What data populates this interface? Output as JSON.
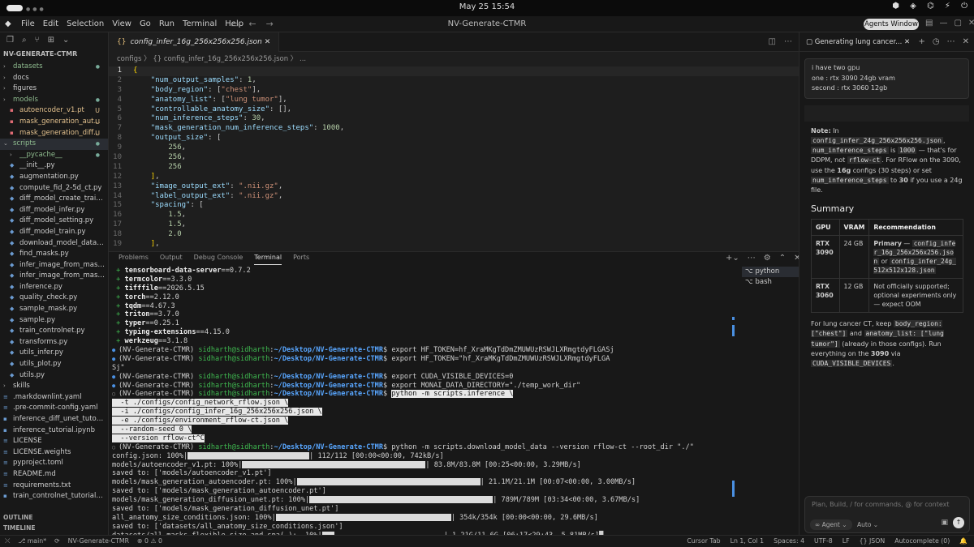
{
  "system": {
    "datetime": "May 25  15:54"
  },
  "menubar": {
    "items": [
      "File",
      "Edit",
      "Selection",
      "View",
      "Go",
      "Run",
      "Terminal",
      "Help"
    ],
    "title": "NV-Generate-CTMR",
    "agents_button": "Agents Window"
  },
  "sidebar": {
    "project": "NV-GENERATE-CTMR",
    "items": [
      {
        "label": "datasets",
        "type": "folder",
        "status": "dot",
        "depth": 0
      },
      {
        "label": "docs",
        "type": "folder",
        "status": "",
        "depth": 0
      },
      {
        "label": "figures",
        "type": "folder",
        "status": "",
        "depth": 0
      },
      {
        "label": "models",
        "type": "folder",
        "status": "dot",
        "depth": 0
      },
      {
        "label": "autoencoder_v1.pt",
        "type": "model",
        "status": "U",
        "depth": 1
      },
      {
        "label": "mask_generation_aut...",
        "type": "model",
        "status": "U",
        "depth": 1
      },
      {
        "label": "mask_generation_diff...",
        "type": "model",
        "status": "U",
        "depth": 1
      },
      {
        "label": "scripts",
        "type": "folder-open",
        "status": "dot",
        "depth": 0,
        "selected": true
      },
      {
        "label": "__pycache__",
        "type": "folder",
        "status": "dot",
        "depth": 1
      },
      {
        "label": "__init__.py",
        "type": "py",
        "status": "",
        "depth": 1
      },
      {
        "label": "augmentation.py",
        "type": "py",
        "status": "",
        "depth": 1
      },
      {
        "label": "compute_fid_2-5d_ct.py",
        "type": "py",
        "status": "",
        "depth": 1
      },
      {
        "label": "diff_model_create_trainin...",
        "type": "py",
        "status": "",
        "depth": 1
      },
      {
        "label": "diff_model_infer.py",
        "type": "py",
        "status": "",
        "depth": 1
      },
      {
        "label": "diff_model_setting.py",
        "type": "py",
        "status": "",
        "depth": 1
      },
      {
        "label": "diff_model_train.py",
        "type": "py",
        "status": "",
        "depth": 1
      },
      {
        "label": "download_model_data.py",
        "type": "py",
        "status": "",
        "depth": 1
      },
      {
        "label": "find_masks.py",
        "type": "py",
        "status": "",
        "depth": 1
      },
      {
        "label": "infer_image_from_mask_b...",
        "type": "py",
        "status": "",
        "depth": 1
      },
      {
        "label": "infer_image_from_mask.py",
        "type": "py",
        "status": "",
        "depth": 1
      },
      {
        "label": "inference.py",
        "type": "py",
        "status": "",
        "depth": 1
      },
      {
        "label": "quality_check.py",
        "type": "py",
        "status": "",
        "depth": 1
      },
      {
        "label": "sample_mask.py",
        "type": "py",
        "status": "",
        "depth": 1
      },
      {
        "label": "sample.py",
        "type": "py",
        "status": "",
        "depth": 1
      },
      {
        "label": "train_controlnet.py",
        "type": "py",
        "status": "",
        "depth": 1
      },
      {
        "label": "transforms.py",
        "type": "py",
        "status": "",
        "depth": 1
      },
      {
        "label": "utils_infer.py",
        "type": "py",
        "status": "",
        "depth": 1
      },
      {
        "label": "utils_plot.py",
        "type": "py",
        "status": "",
        "depth": 1
      },
      {
        "label": "utils.py",
        "type": "py",
        "status": "",
        "depth": 1
      },
      {
        "label": "skills",
        "type": "folder",
        "status": "",
        "depth": 0
      },
      {
        "label": ".markdownlint.yaml",
        "type": "file",
        "status": "",
        "depth": 0
      },
      {
        "label": ".pre-commit-config.yaml",
        "type": "file",
        "status": "",
        "depth": 0
      },
      {
        "label": "inference_diff_unet_tutorial...",
        "type": "nb",
        "status": "",
        "depth": 0
      },
      {
        "label": "inference_tutorial.ipynb",
        "type": "nb",
        "status": "",
        "depth": 0
      },
      {
        "label": "LICENSE",
        "type": "file",
        "status": "",
        "depth": 0
      },
      {
        "label": "LICENSE.weights",
        "type": "file",
        "status": "",
        "depth": 0
      },
      {
        "label": "pyproject.toml",
        "type": "file",
        "status": "",
        "depth": 0
      },
      {
        "label": "README.md",
        "type": "file",
        "status": "",
        "depth": 0
      },
      {
        "label": "requirements.txt",
        "type": "file",
        "status": "",
        "depth": 0
      },
      {
        "label": "train_controlnet_tutorial.ipy...",
        "type": "nb",
        "status": "",
        "depth": 0
      }
    ],
    "outline": "OUTLINE",
    "timeline": "TIMELINE"
  },
  "editor": {
    "tab": "config_infer_16g_256x256x256.json",
    "breadcrumb": "configs 〉 {} config_infer_16g_256x256x256.json 〉 ...",
    "lines": [
      "{",
      "    \"num_output_samples\": 1,",
      "    \"body_region\": [\"chest\"],",
      "    \"anatomy_list\": [\"lung tumor\"],",
      "    \"controllable_anatomy_size\": [],",
      "    \"num_inference_steps\": 30,",
      "    \"mask_generation_num_inference_steps\": 1000,",
      "    \"output_size\": [",
      "        256,",
      "        256,",
      "        256",
      "    ],",
      "    \"image_output_ext\": \".nii.gz\",",
      "    \"label_output_ext\": \".nii.gz\",",
      "    \"spacing\": [",
      "        1.5,",
      "        1.5,",
      "        2.0",
      "    ],"
    ]
  },
  "panel": {
    "tabs": [
      "Problems",
      "Output",
      "Debug Console",
      "Terminal",
      "Ports"
    ],
    "active": "Terminal",
    "terminals": [
      "python",
      "bash"
    ],
    "terminal_lines": [
      "+ tensorboard-data-server==0.7.2",
      "+ termcolor==3.3.0",
      "+ tifffile==2026.5.15",
      "+ torch==2.12.0",
      "+ tqdm==4.67.3",
      "+ triton==3.7.0",
      "+ typer==0.25.1",
      "+ typing-extensions==4.15.0",
      "+ werkzeug==3.1.8",
      "(NV-Generate-CTMR) sidharth@sidharth:~/Desktop/NV-Generate-CTMR$ export HF_TOKEN=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",
      "(NV-Generate-CTMR) sidharth@sidharth:~/Desktop/NV-Generate-CTMR$ export HF_TOKEN=\"hf_XraMKgTdDmZMUWUzRSWJLXRmgtdyFLGA",
      "Sj\"",
      "(NV-Generate-CTMR) sidharth@sidharth:~/Desktop/NV-Generate-CTMR$ export CUDA_VISIBLE_DEVICES=0",
      "(NV-Generate-CTMR) sidharth@sidharth:~/Desktop/NV-Generate-CTMR$ export MONAI_DATA_DIRECTORY=\"./temp_work_dir\"",
      "(NV-Generate-CTMR) sidharth@sidharth:~/Desktop/NV-Generate-CTMR$ python -m scripts.inference \\",
      "  -t ./configs/config_network_rflow.json \\",
      "  -i ./configs/config_infer_16g_256x256x256.json \\",
      "  -e ./configs/environment_rflow-ct.json \\",
      "  --random-seed 0 \\",
      "  --version rflow-ct^C",
      "(NV-Generate-CTMR) sidharth@sidharth:~/Desktop/NV-Generate-CTMR$ python -m scripts.download_model_data --version rflow-ct --root_dir \"./\"",
      "config.json: 100%|",
      "models/autoencoder_v1.pt: 100%|",
      "saved to: ['models/autoencoder_v1.pt']",
      "models/mask_generation_autoencoder.pt: 100%|",
      "saved to: ['models/mask_generation_autoencoder.pt']",
      "models/mask_generation_diffusion_unet.pt: 100%|",
      "saved to: ['models/mask_generation_diffusion_unet.pt']",
      "all_anatomy_size_conditions.json: 100%|",
      "saved to: ['datasets/all_anatomy_size_conditions.json']",
      "datasets/all_masks_flexible_size_and_spa(…):  10%|"
    ],
    "progress": [
      {
        "line": 21,
        "tail": "| 112/112 [00:00<00:00, 742kB/s]",
        "fill": 1.0
      },
      {
        "line": 22,
        "tail": "| 83.8M/83.8M [00:25<00:00, 3.29MB/s]",
        "fill": 1.0
      },
      {
        "line": 24,
        "tail": "| 21.1M/21.1M [00:07<00:00, 3.00MB/s]",
        "fill": 1.0
      },
      {
        "line": 26,
        "tail": "| 789M/789M [03:34<00:00, 3.67MB/s]",
        "fill": 1.0
      },
      {
        "line": 28,
        "tail": "| 354k/354k [00:00<00:00, 29.6MB/s]",
        "fill": 1.0
      },
      {
        "line": 30,
        "tail": "| 1.21G/11.6G [06:17<29:43, 5.81MB/s]",
        "fill": 0.1
      }
    ]
  },
  "agent": {
    "tab_title": "Generating lung cancer...",
    "user_message": [
      "i have two gpu",
      "one : rtx 3090 24gb vram",
      "second : rtx 3060 12gb"
    ],
    "code_lines": [
      {
        "t": "c",
        "v": "# 4) Download weights + mask DB (needed"
      },
      {
        "t": "x",
        "v": "python -m scripts.download_model_data --"
      },
      {
        "t": "x",
        "v": ""
      },
      {
        "t": "c",
        "v": "# 5) Run on 3090"
      },
      {
        "t": "x",
        "v": "python -m scripts.inference \\"
      },
      {
        "t": "x",
        "v": "  -t ./configs/config_network_rflow.json"
      },
      {
        "t": "x",
        "v": "  -i ./configs/config_infer_16g_256x256x"
      },
      {
        "t": "x",
        "v": "  -e ./configs/environment_rflow-ct.json"
      },
      {
        "t": "x",
        "v": "  --random-seed 0 \\"
      },
      {
        "t": "x",
        "v": "  --version rflow-ct"
      }
    ],
    "note": {
      "prefix": "Note:",
      "p1": " In ",
      "c1": "config_infer_24g_256x256x256.json",
      "p2": ", ",
      "c2": "num_inference_steps",
      "p3": " is ",
      "c3": "1000",
      "p4": " — that's for DDPM, not ",
      "c4": "rflow-ct",
      "p5": ". For RFlow on the 3090, use the ",
      "b1": "16g",
      "p6": " configs (30 steps) or set ",
      "c5": "num_inference_steps",
      "p7": " to ",
      "b2": "30",
      "p8": " if you use a 24g file."
    },
    "summary_title": "Summary",
    "table": {
      "headers": [
        "GPU",
        "VRAM",
        "Recommendation"
      ],
      "rows": [
        {
          "gpu": "RTX 3090",
          "vram": "24 GB",
          "rec_bold": "Primary",
          "rec_text": " — ",
          "rec_code1": "config_infer_16g_256x256x256.json",
          "rec_mid": " or ",
          "rec_code2": "config_infer_24g_512x512x128.json"
        },
        {
          "gpu": "RTX 3060",
          "vram": "12 GB",
          "rec_bold": "",
          "rec_text": "Not officially supported; optional experiments only — expect OOM",
          "rec_code1": "",
          "rec_mid": "",
          "rec_code2": ""
        }
      ]
    },
    "footer": {
      "p1": "For lung cancer CT, keep ",
      "c1": "body_region: [\"chest\"]",
      "p2": " and ",
      "c2": "anatomy_list: [\"lung tumor\"]",
      "p3": " (already in those configs). Run everything on the ",
      "b1": "3090",
      "p4": " via ",
      "c3": "CUDA_VISIBLE_DEVICES",
      "p5": "."
    },
    "input_placeholder": "Plan, Build, / for commands, @ for context",
    "mode": "∞ Agent ⌄",
    "model": "Auto ⌄"
  },
  "statusbar": {
    "left": [
      "⤬",
      "⎇ main*",
      "⟳",
      "NV-Generate-CTMR",
      "⊗ 0 ⚠ 0"
    ],
    "right": [
      "Cursor Tab",
      "Ln 1, Col 1",
      "Spaces: 4",
      "UTF-8",
      "LF",
      "{} JSON",
      "Autocomplete (0)",
      "🔔"
    ]
  }
}
